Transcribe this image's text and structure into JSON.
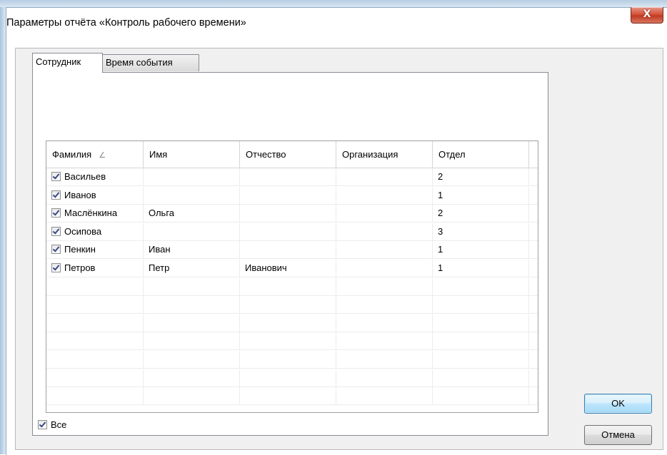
{
  "window": {
    "title": "Параметры отчёта «Контроль рабочего времени»",
    "close_glyph": "X"
  },
  "tabs": [
    {
      "label": "Сотрудник",
      "active": true
    },
    {
      "label": "Время события",
      "active": false
    }
  ],
  "grid": {
    "columns": [
      "Фамилия",
      "Имя",
      "Отчество",
      "Организация",
      "Отдел"
    ],
    "sort_column": "Фамилия",
    "sort_icon": "sort-ascending-icon",
    "rows": [
      {
        "checked": true,
        "surname": "Васильев",
        "name": "",
        "patronymic": "",
        "org": "",
        "dept": "2"
      },
      {
        "checked": true,
        "surname": "Иванов",
        "name": "",
        "patronymic": "",
        "org": "",
        "dept": "1"
      },
      {
        "checked": true,
        "surname": "Маслёнкина",
        "name": "Ольга",
        "patronymic": "",
        "org": "",
        "dept": "2"
      },
      {
        "checked": true,
        "surname": "Осипова",
        "name": "",
        "patronymic": "",
        "org": "",
        "dept": "3"
      },
      {
        "checked": true,
        "surname": "Пенкин",
        "name": "Иван",
        "patronymic": "",
        "org": "",
        "dept": "1"
      },
      {
        "checked": true,
        "surname": "Петров",
        "name": "Петр",
        "patronymic": "Иванович",
        "org": "",
        "dept": "1"
      }
    ]
  },
  "select_all": {
    "label": "Все",
    "checked": true
  },
  "buttons": {
    "ok": "OK",
    "cancel": "Отмена"
  },
  "colors": {
    "accent_border": "#3c7fb1",
    "close_red": "#c23a22",
    "checkmark": "#3a4a8a"
  }
}
